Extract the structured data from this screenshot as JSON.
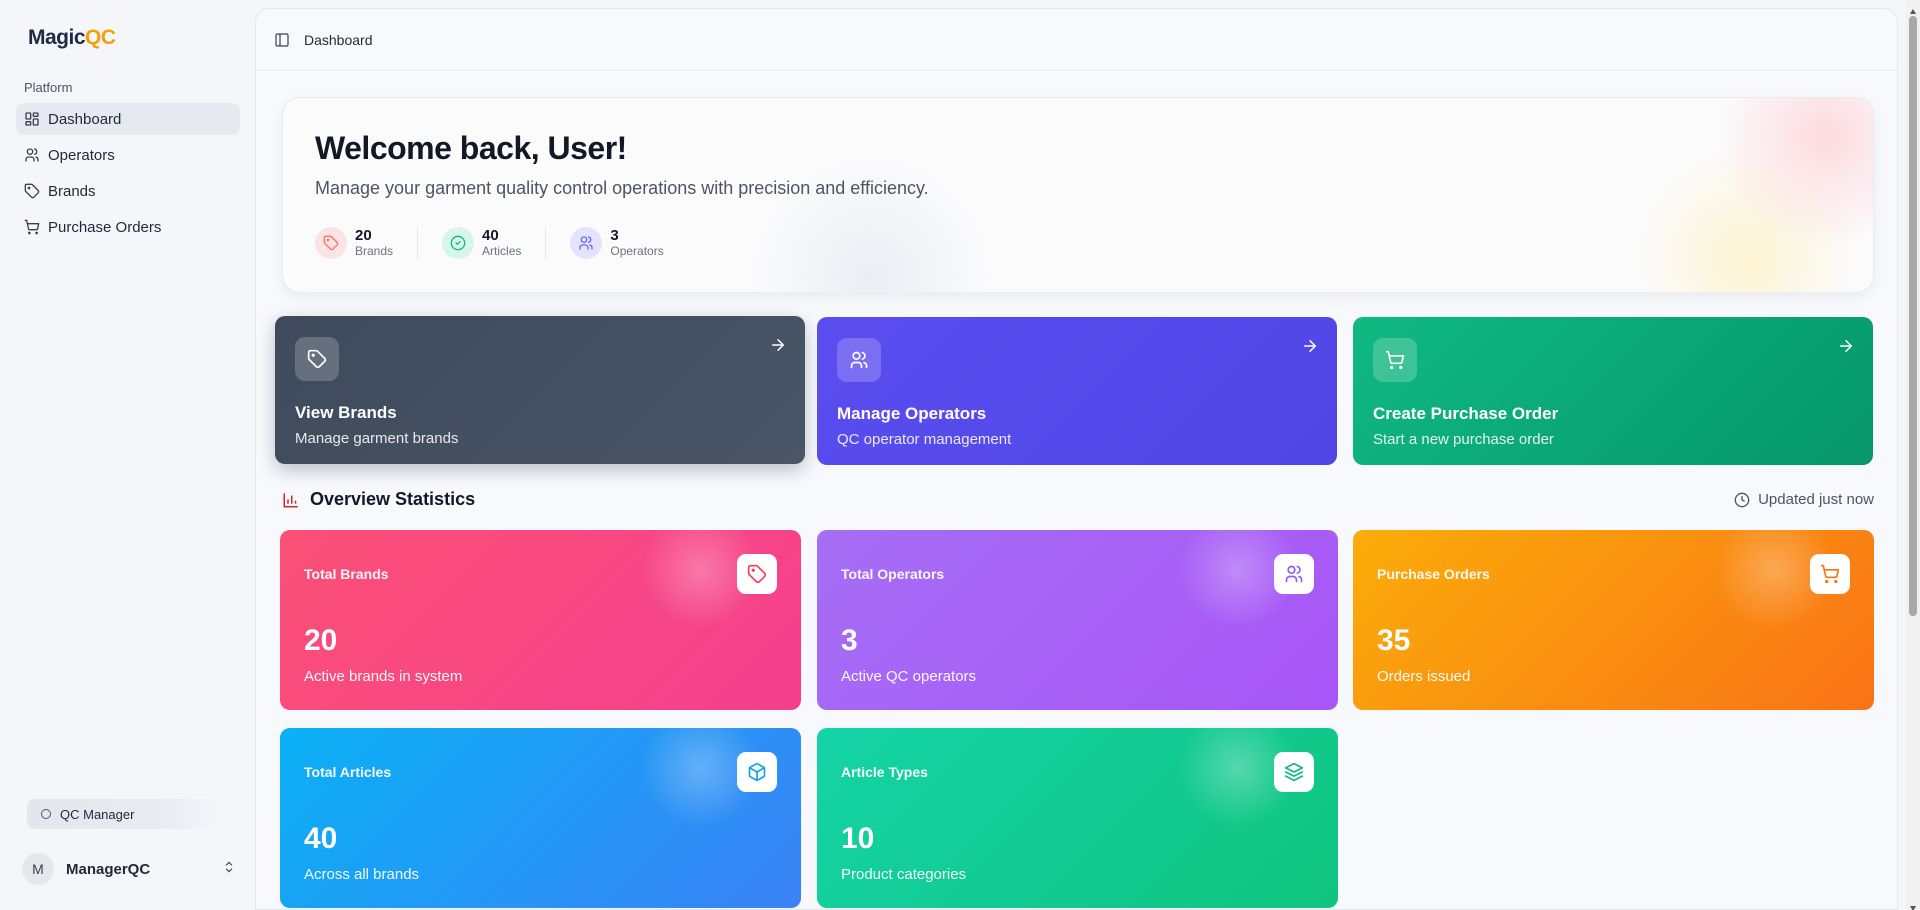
{
  "brand": {
    "name_part1": "Magic",
    "name_part2": "QC"
  },
  "sidebar": {
    "group_label": "Platform",
    "items": [
      {
        "label": "Dashboard",
        "icon": "dashboard-grid-icon",
        "active": true
      },
      {
        "label": "Operators",
        "icon": "users-icon"
      },
      {
        "label": "Brands",
        "icon": "tag-icon"
      },
      {
        "label": "Purchase Orders",
        "icon": "cart-icon"
      }
    ],
    "role_badge": "QC Manager",
    "user": {
      "initial": "M",
      "name": "ManagerQC"
    }
  },
  "topbar": {
    "breadcrumb": "Dashboard"
  },
  "welcome": {
    "title": "Welcome back, User!",
    "subtitle": "Manage your garment quality control operations with precision and efficiency.",
    "stats": [
      {
        "value": "20",
        "label": "Brands"
      },
      {
        "value": "40",
        "label": "Articles"
      },
      {
        "value": "3",
        "label": "Operators"
      }
    ]
  },
  "actions": [
    {
      "title": "View Brands",
      "subtitle": "Manage garment brands",
      "color": "#3f4a5c"
    },
    {
      "title": "Manage Operators",
      "subtitle": "QC operator management",
      "color": "#4f46e5"
    },
    {
      "title": "Create Purchase Order",
      "subtitle": "Start a new purchase order",
      "color": "#059669"
    }
  ],
  "overview": {
    "title": "Overview Statistics",
    "updated": "Updated just now",
    "cards": [
      {
        "label": "Total Brands",
        "value": "20",
        "desc": "Active brands in system",
        "icon": "tag-icon"
      },
      {
        "label": "Total Operators",
        "value": "3",
        "desc": "Active QC operators",
        "icon": "users-icon"
      },
      {
        "label": "Purchase Orders",
        "value": "35",
        "desc": "Orders issued",
        "icon": "cart-icon"
      },
      {
        "label": "Total Articles",
        "value": "40",
        "desc": "Across all brands",
        "icon": "box-icon"
      },
      {
        "label": "Article Types",
        "value": "10",
        "desc": "Product categories",
        "icon": "layers-icon"
      }
    ]
  }
}
